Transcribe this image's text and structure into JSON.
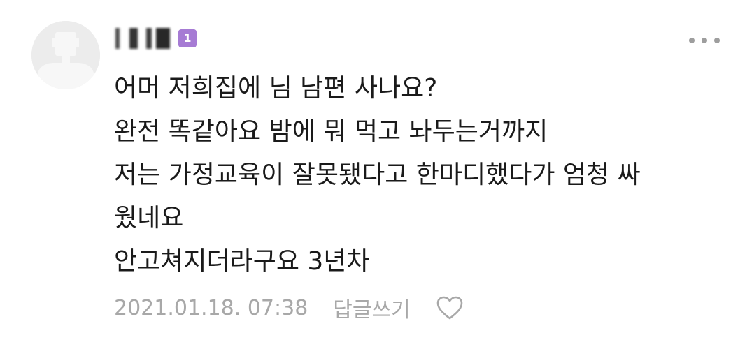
{
  "comment": {
    "author": {
      "nickname_obscured": true,
      "badge": "1",
      "badge_color": "#a67bd4"
    },
    "body_lines": [
      "어머 저희집에 님 남편 사나요?",
      "완전 똑같아요 밤에 뭐 먹고 놔두는거까지",
      "저는 가정교육이 잘못됐다고 한마디했다가 엄청 싸",
      "웠네요",
      "안고쳐지더라구요 3년차"
    ],
    "timestamp": "2021.01.18. 07:38",
    "reply_label": "답글쓰기",
    "icons": {
      "avatar": "default-user-avatar-icon",
      "more": "more-options-icon",
      "like": "heart-outline-icon"
    }
  }
}
